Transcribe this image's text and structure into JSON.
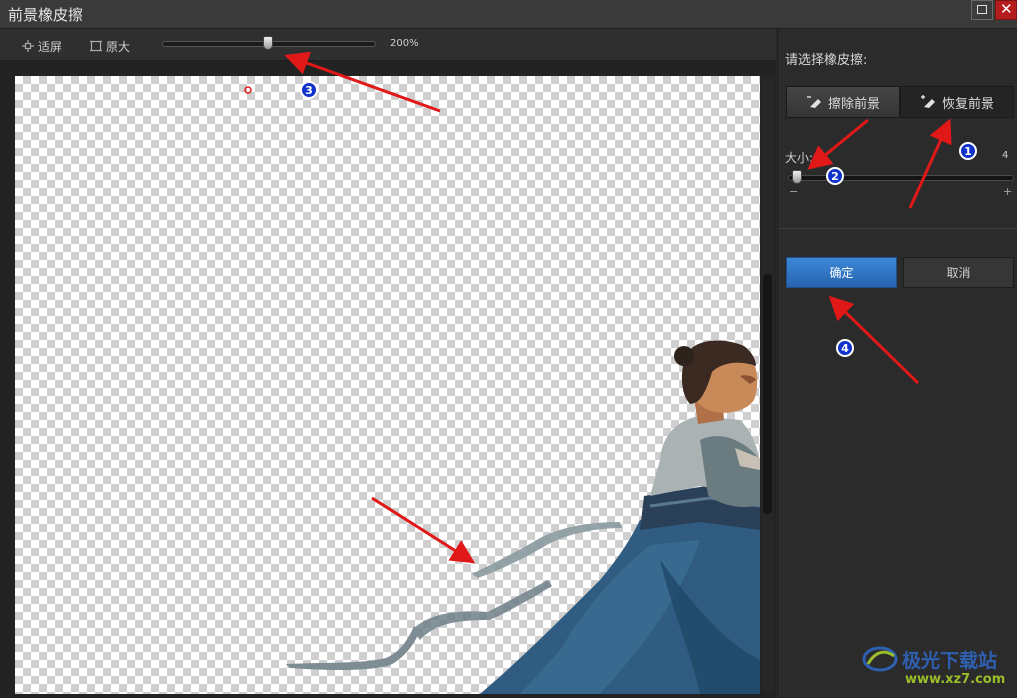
{
  "window": {
    "title": "前景橡皮擦"
  },
  "toolbar": {
    "fit_label": "适屏",
    "original_label": "原大",
    "zoom_value": "200%",
    "zoom_fraction": 0.47
  },
  "panel": {
    "heading": "请选择橡皮擦:",
    "erase_label": "擦除前景",
    "restore_label": "恢复前景",
    "size_label": "大小:",
    "size_value": "4",
    "size_fraction": 0.02,
    "minus": "−",
    "plus": "+",
    "ok_label": "确定",
    "cancel_label": "取消"
  },
  "annotations": {
    "badge1": "1",
    "badge2": "2",
    "badge3": "3",
    "badge4": "4",
    "arrow_color": "#e01818"
  },
  "watermark": {
    "text": "极光下载站",
    "sub": "www.xz7.com"
  }
}
